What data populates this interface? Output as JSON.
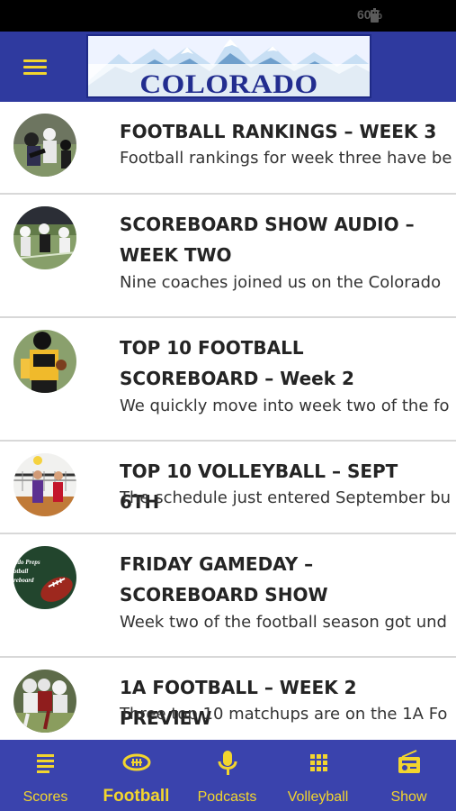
{
  "status_bar": {
    "battery": "60%"
  },
  "app_bar": {
    "logo_text": "COLORADO PREPS",
    "menu_icon": "hamburger-menu-icon"
  },
  "articles": [
    {
      "title": "FOOTBALL RANKINGS – WEEK 3",
      "excerpt": "Football rankings for week three have be"
    },
    {
      "title": "SCOREBOARD SHOW AUDIO – WEEK TWO",
      "excerpt": "Nine coaches joined us on the Colorado"
    },
    {
      "title": "TOP 10 FOOTBALL SCOREBOARD – Week 2",
      "excerpt": "We quickly move into week two of the fo"
    },
    {
      "title": "TOP 10 VOLLEYBALL – SEPT 6TH",
      "excerpt": "The schedule just entered September bu"
    },
    {
      "title": "FRIDAY GAMEDAY – SCOREBOARD SHOW",
      "excerpt": "Week two of the football season got und",
      "thumb_text": [
        "ado Preps",
        "otball",
        "reboard"
      ]
    },
    {
      "title": "1A FOOTBALL – WEEK 2 PREVIEW",
      "excerpt": "Three top 10 matchups are on the 1A Fo"
    }
  ],
  "bottom_nav": {
    "items": [
      {
        "label": "Scores",
        "icon": "list-icon"
      },
      {
        "label": "Football",
        "icon": "football-icon",
        "active": true
      },
      {
        "label": "Podcasts",
        "icon": "microphone-icon"
      },
      {
        "label": "Volleyball",
        "icon": "grid-icon"
      },
      {
        "label": "Show",
        "icon": "radio-icon"
      }
    ]
  },
  "colors": {
    "app_bar": "#2f3a9f",
    "accent": "#f2d52e",
    "bottom_nav": "#3a43ad"
  }
}
